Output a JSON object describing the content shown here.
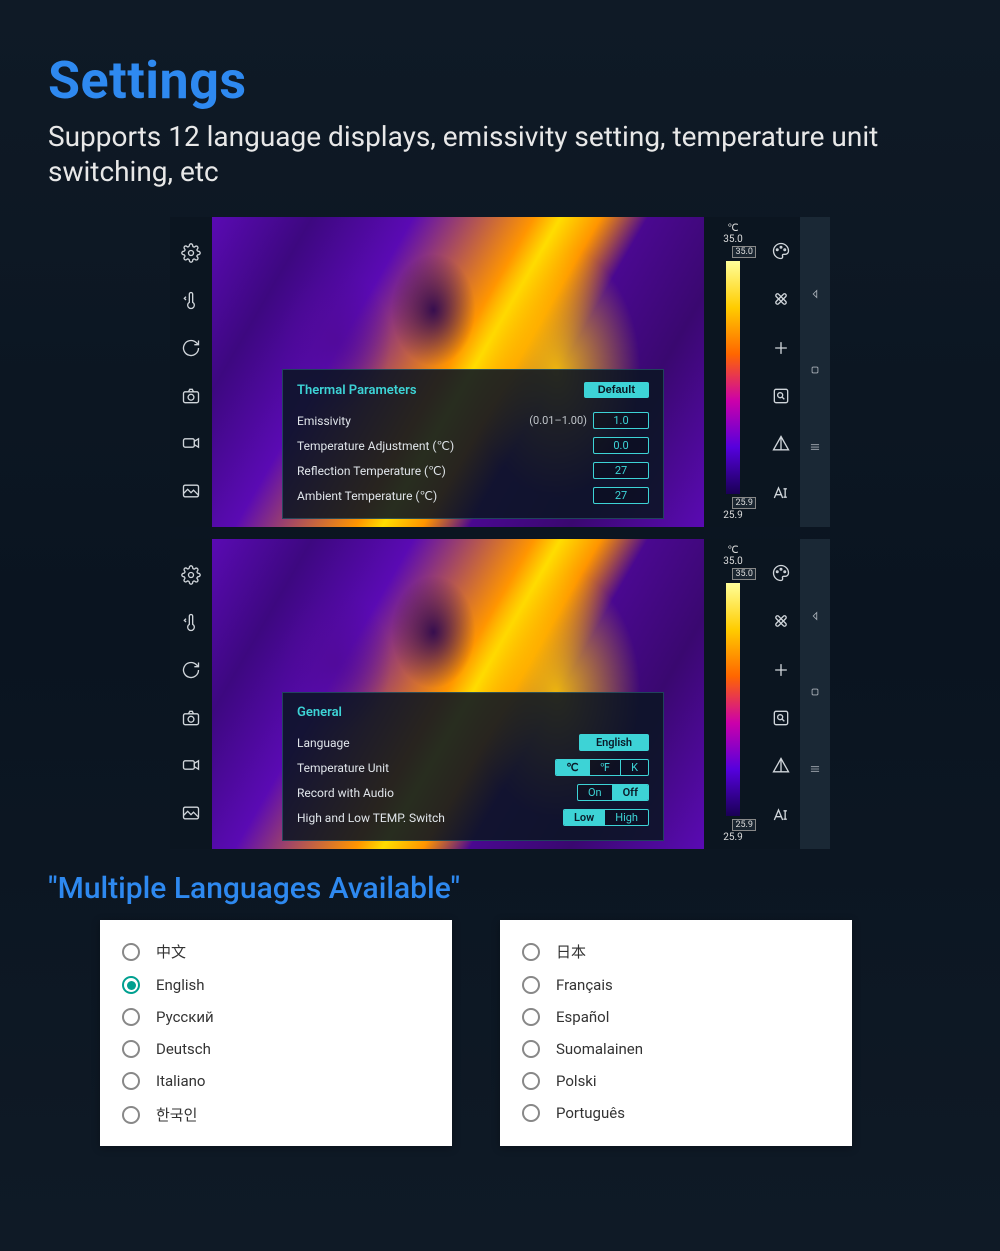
{
  "header": {
    "title": "Settings",
    "subtitle": "Supports 12 language displays, emissivity setting, temperature unit switching, etc"
  },
  "shot1": {
    "panel_title": "Thermal Parameters",
    "default_btn": "Default",
    "rows": [
      {
        "label": "Emissivity",
        "hint": "(0.01–1.00)",
        "value": "1.0"
      },
      {
        "label": "Temperature Adjustment (℃)",
        "hint": "",
        "value": "0.0"
      },
      {
        "label": "Reflection Temperature (℃)",
        "hint": "",
        "value": "27"
      },
      {
        "label": "Ambient Temperature (℃)",
        "hint": "",
        "value": "27"
      }
    ],
    "scale": {
      "unit": "℃",
      "max": "35.0",
      "max_tag": "35.0",
      "min": "25.9",
      "min_tag": "25.9"
    }
  },
  "shot2": {
    "panel_title": "General",
    "lang_label": "Language",
    "lang_value": "English",
    "unit_label": "Temperature Unit",
    "units": [
      "℃",
      "℉",
      "K"
    ],
    "unit_active": 0,
    "audio_label": "Record with Audio",
    "audio_opts": [
      "On",
      "Off"
    ],
    "audio_active": 1,
    "switch_label": "High and Low TEMP. Switch",
    "switch_opts": [
      "Low",
      "High"
    ],
    "switch_active": 0,
    "scale": {
      "unit": "℃",
      "max": "35.0",
      "max_tag": "35.0",
      "min": "25.9",
      "min_tag": "25.9"
    }
  },
  "langs_title": "\"Multiple Languages Available\"",
  "langs_left": [
    {
      "label": "中文",
      "checked": false
    },
    {
      "label": "English",
      "checked": true
    },
    {
      "label": "Русский",
      "checked": false
    },
    {
      "label": "Deutsch",
      "checked": false
    },
    {
      "label": "Italiano",
      "checked": false
    },
    {
      "label": "한국인",
      "checked": false
    }
  ],
  "langs_right": [
    {
      "label": "日本",
      "checked": false
    },
    {
      "label": "Français",
      "checked": false
    },
    {
      "label": "Español",
      "checked": false
    },
    {
      "label": "Suomalainen",
      "checked": false
    },
    {
      "label": "Polski",
      "checked": false
    },
    {
      "label": "Português",
      "checked": false
    }
  ]
}
